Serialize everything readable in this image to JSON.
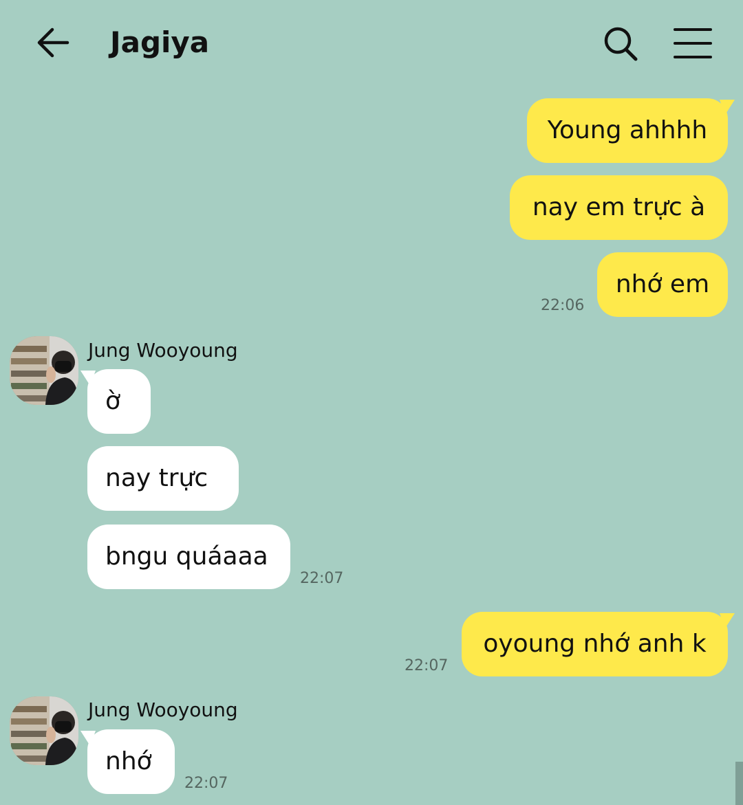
{
  "header": {
    "title": "Jagiya",
    "back_icon": "arrow-left-icon",
    "search_icon": "search-icon",
    "menu_icon": "hamburger-menu-icon"
  },
  "colors": {
    "background": "#a6cec2",
    "my_bubble": "#fee94b",
    "their_bubble": "#ffffff"
  },
  "messages": {
    "m1": {
      "text": "Young ahhhh"
    },
    "m2": {
      "text": "nay em trực à"
    },
    "m3": {
      "text": "nhớ em",
      "time": "22:06"
    },
    "g1": {
      "sender": "Jung Wooyoung",
      "b1": "ờ",
      "b2": "nay trực",
      "b3": "bngu quáaaa",
      "time": "22:07"
    },
    "m4": {
      "text": "oyoung nhớ anh k",
      "time": "22:07"
    },
    "g2": {
      "sender": "Jung Wooyoung",
      "b1": "nhớ",
      "time": "22:07"
    }
  }
}
